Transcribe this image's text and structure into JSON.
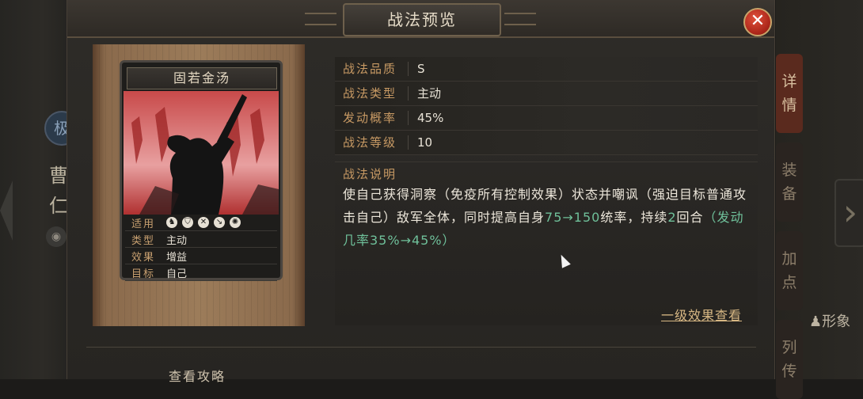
{
  "modal": {
    "title": "战法预览",
    "close_icon": "close-icon"
  },
  "card": {
    "name": "固若金汤",
    "attrs": [
      {
        "key": "适用",
        "value": "",
        "icons": [
          "mounted-unit-icon",
          "shield-unit-icon",
          "archer-unit-icon",
          "spear-unit-icon",
          "siege-unit-icon"
        ]
      },
      {
        "key": "类型",
        "value": "主动"
      },
      {
        "key": "效果",
        "value": "增益"
      },
      {
        "key": "目标",
        "value": "自己"
      }
    ]
  },
  "info": {
    "quality_label": "战法品质",
    "quality_value": "S",
    "type_label": "战法类型",
    "type_value": "主动",
    "rate_label": "发动概率",
    "rate_value": "45%",
    "level_label": "战法等级",
    "level_value": "10"
  },
  "description": {
    "title": "战法说明",
    "part1": "使自己获得洞察（免疫所有控制效果）状态并嘲讽（强迫目标普通攻击自己）敌军全体，同时提高自身",
    "range": "75→150",
    "part2": "统率，持续",
    "duration_num": "2",
    "part3": "回合",
    "note": "（发动几率35%→45%）",
    "link": "一级效果查看"
  },
  "footer": {
    "guide": "查看攻略"
  },
  "background": {
    "left_name_1": "曹",
    "left_name_2": "仁",
    "left_badge": "极",
    "side_tabs": [
      {
        "label1": "详",
        "label2": "情"
      },
      {
        "label1": "装",
        "label2": "备"
      },
      {
        "label1": "加",
        "label2": "点"
      },
      {
        "label1": "列",
        "label2": "传"
      }
    ],
    "right_label": "形象"
  },
  "colors": {
    "label_gold": "#c89a64",
    "green_value": "#6fc09a",
    "close_red": "#c8301e"
  }
}
